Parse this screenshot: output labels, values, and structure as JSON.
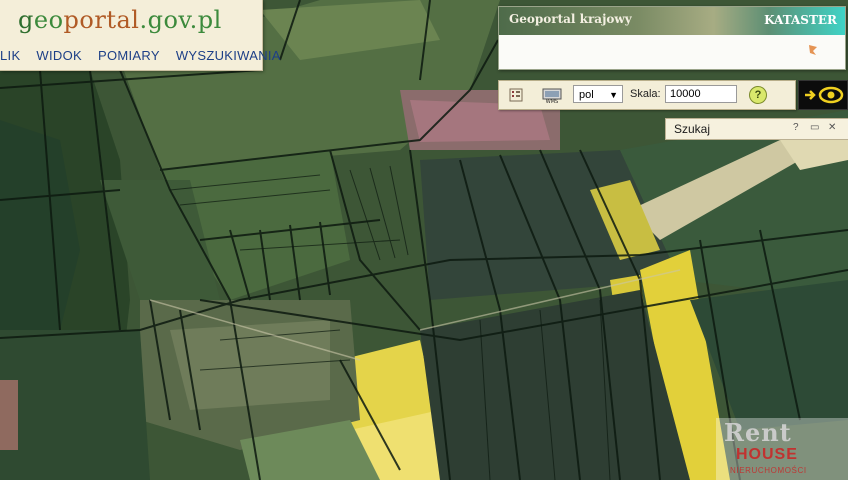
{
  "logo": {
    "g": "g",
    "geo": "eo",
    "portal": "portal",
    "gov": ".gov.pl"
  },
  "menu": {
    "items": [
      "LIK",
      "WIDOK",
      "POMIARY",
      "WYSZUKIWANIA"
    ]
  },
  "banner": {
    "title": "Geoportal krajowy",
    "layer": "KATASTER"
  },
  "toolbar": {
    "print_icon": "grid-list-icon",
    "wms_icon": "wms-icon",
    "language": "pol",
    "scale_label": "Skala:",
    "scale_value": "10000",
    "help_label": "?"
  },
  "search": {
    "title": "Szukaj",
    "help": "?",
    "minimize": "▭",
    "close": "✕"
  },
  "watermark": {
    "line1": "Rent",
    "line2": "HOUSE",
    "line3": "NIERUCHOMOŚCI"
  },
  "colors": {
    "forest": "#2f4a2d",
    "field_green": "#4f6d3e",
    "field_dark": "#2c3b30",
    "canola": "#e3d23a",
    "parcel_line": "#0d1a10",
    "menu_link": "#1d3f87"
  }
}
